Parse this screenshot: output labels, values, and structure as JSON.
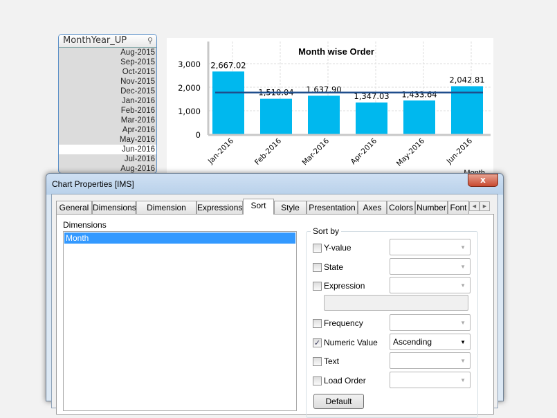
{
  "listbox": {
    "title": "MonthYear_UP",
    "icon": "search-icon",
    "items": [
      "Aug-2015",
      "Sep-2015",
      "Oct-2015",
      "Nov-2015",
      "Dec-2015",
      "Jan-2016",
      "Feb-2016",
      "Mar-2016",
      "Apr-2016",
      "May-2016",
      "Jun-2016",
      "Jul-2016",
      "Aug-2016"
    ],
    "selected": "Jun-2016"
  },
  "chart_data": {
    "type": "bar",
    "title": "Month wise Order",
    "xlabel": "Month",
    "categories": [
      "Jan-2016",
      "Feb-2016",
      "Mar-2016",
      "Apr-2016",
      "May-2016",
      "Jun-2016"
    ],
    "values": [
      2667.02,
      1510.04,
      1637.9,
      1347.03,
      1433.64,
      2042.81
    ],
    "data_labels": [
      "2,667.02",
      "1,510.04",
      "1,637.90",
      "1,347.03",
      "1,433.64",
      "2,042.81"
    ],
    "yticks": [
      "0",
      "1,000",
      "2,000",
      "3,000"
    ],
    "ylim": [
      0,
      3000
    ],
    "reference_line": 1773,
    "grid": true,
    "bar_color": "#00b8ee",
    "line_color": "#1f4e8c"
  },
  "dialog": {
    "title": "Chart Properties [IMS]",
    "close": "x",
    "tabs": [
      "General",
      "Dimensions",
      "Dimension Limits",
      "Expressions",
      "Sort",
      "Style",
      "Presentation",
      "Axes",
      "Colors",
      "Number",
      "Font"
    ],
    "active_tab": "Sort",
    "dimensions_label": "Dimensions",
    "dimensions": [
      "Month"
    ],
    "sort_by_label": "Sort by",
    "sort_options": [
      {
        "label": "Y-value",
        "checked": false,
        "value": ""
      },
      {
        "label": "State",
        "checked": false,
        "value": ""
      },
      {
        "label": "Expression",
        "checked": false,
        "value": ""
      },
      {
        "label": "Frequency",
        "checked": false,
        "value": ""
      },
      {
        "label": "Numeric Value",
        "checked": true,
        "value": "Ascending"
      },
      {
        "label": "Text",
        "checked": false,
        "value": ""
      },
      {
        "label": "Load Order",
        "checked": false,
        "value": ""
      }
    ],
    "default_button": "Default"
  }
}
